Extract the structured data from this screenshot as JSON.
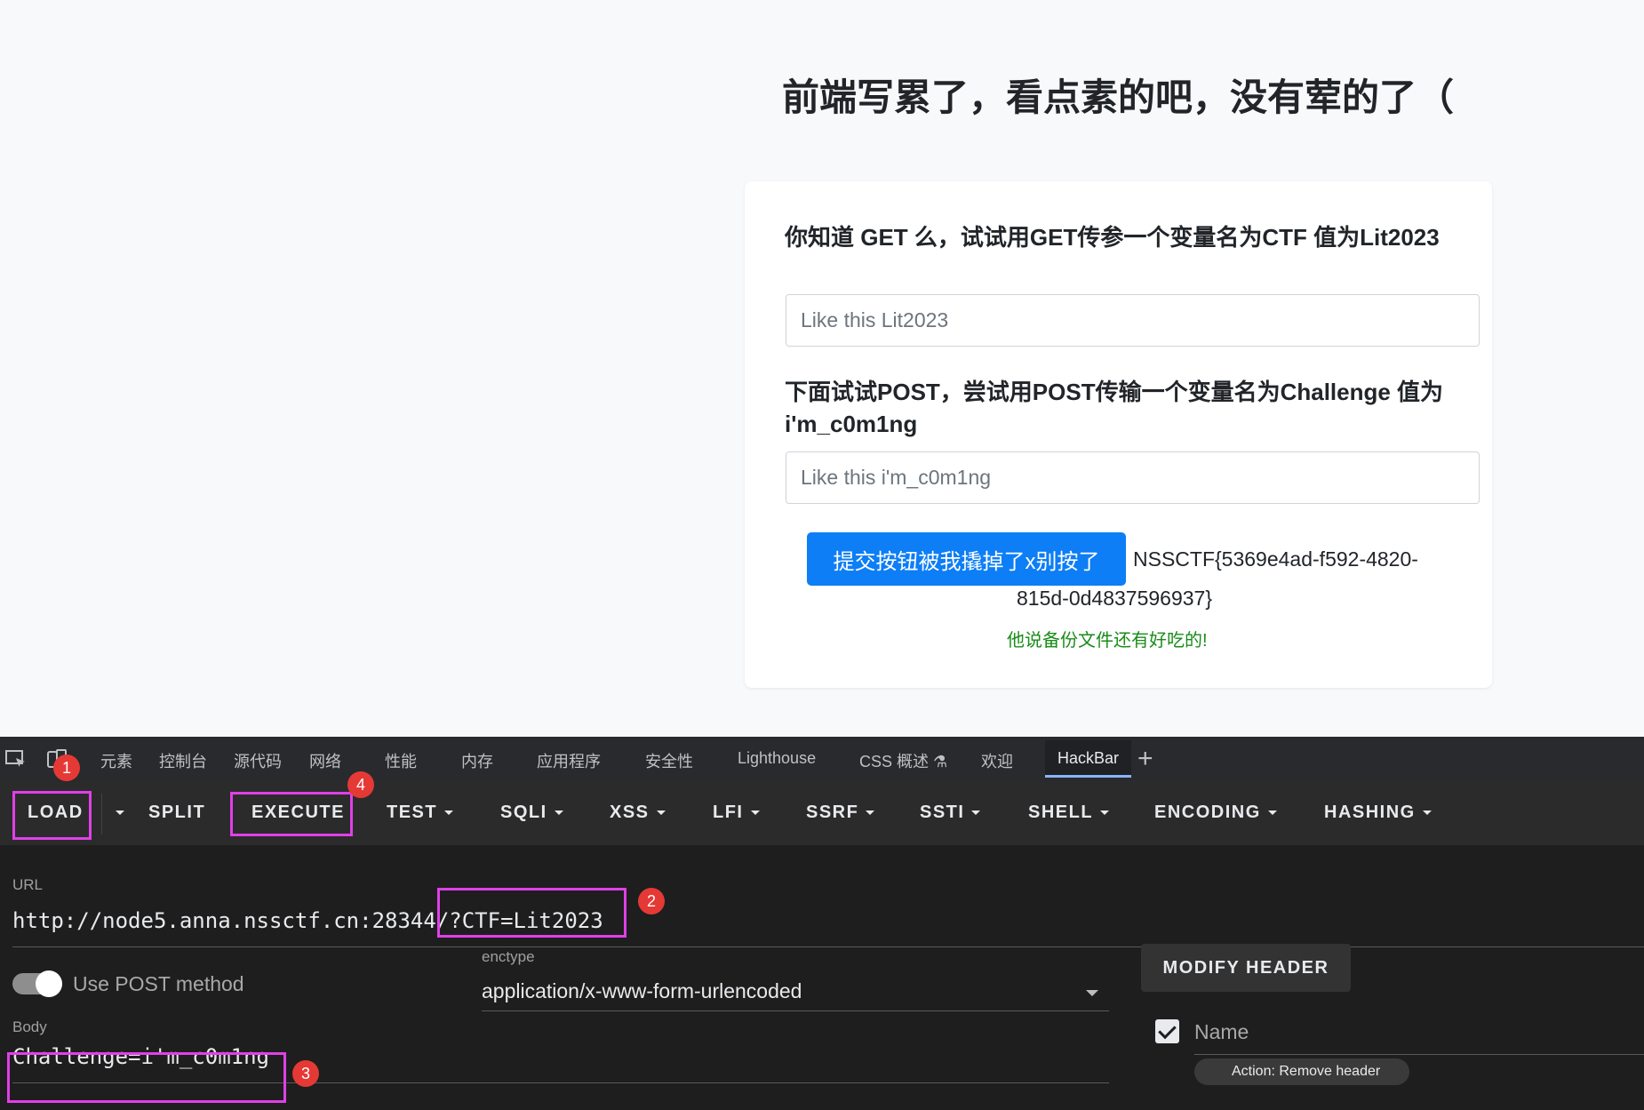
{
  "page": {
    "title": "前端写累了，看点素的吧，没有荤的了（",
    "get_prompt": "你知道 GET 么，试试用GET传参一个变量名为CTF 值为Lit2023",
    "get_placeholder": "Like this Lit2023",
    "post_prompt": "下面试试POST，尝试用POST传输一个变量名为Challenge 值为 i'm_c0m1ng",
    "post_placeholder": "Like this i'm_c0m1ng",
    "submit_label": "提交按钮被我撬掉了x别按了",
    "flag_line1": "NSSCTF{5369e4ad-f592-4820-",
    "flag_line2": "815d-0d4837596937}",
    "hint": "他说备份文件还有好吃的!"
  },
  "devtools": {
    "tabs": [
      "元素",
      "控制台",
      "源代码",
      "网络",
      "性能",
      "内存",
      "应用程序",
      "安全性",
      "Lighthouse",
      "CSS 概述 ⚗",
      "欢迎",
      "HackBar"
    ],
    "active_tab": "HackBar",
    "hackbar": {
      "buttons": {
        "load": "LOAD",
        "split": "SPLIT",
        "execute": "EXECUTE",
        "test": "TEST",
        "sqli": "SQLI",
        "xss": "XSS",
        "lfi": "LFI",
        "ssrf": "SSRF",
        "ssti": "SSTI",
        "shell": "SHELL",
        "encoding": "ENCODING",
        "hashing": "HASHING"
      },
      "url_label": "URL",
      "url_base": "http://node5.anna.nssctf.cn:28344",
      "url_query": "/?CTF=Lit2023",
      "post_toggle_label": "Use POST method",
      "enctype_label": "enctype",
      "enctype_value": "application/x-www-form-urlencoded",
      "modify_header_label": "MODIFY HEADER",
      "body_label": "Body",
      "body_value": "Challenge=i'm_c0m1ng",
      "header_name_label": "Name",
      "action_chip_label": "Action: Remove header"
    }
  },
  "annotations": {
    "badges": [
      "1",
      "2",
      "3",
      "4"
    ],
    "highlight_color": "#e040e8",
    "badge_color": "#e53935"
  },
  "colors": {
    "primary_button": "#0d7ef5",
    "hint_text": "#198c19",
    "devtools_bg": "#202124",
    "active_tab_border": "#8ab4f8"
  }
}
